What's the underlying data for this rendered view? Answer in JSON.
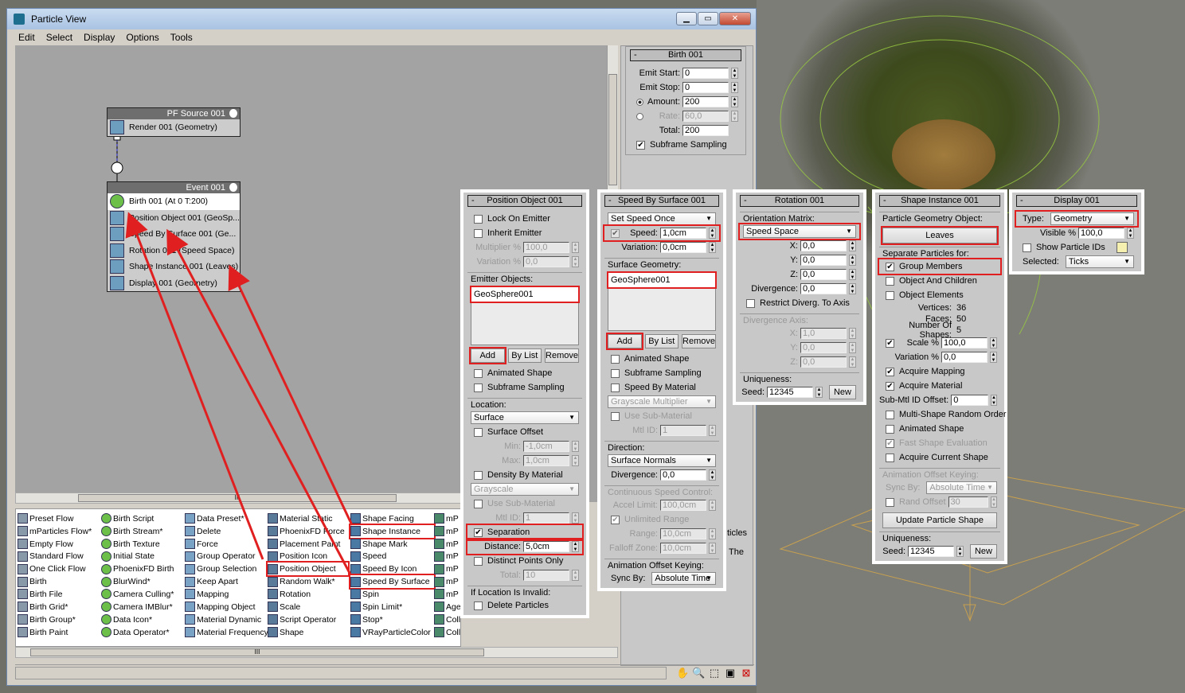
{
  "window": {
    "title": "Particle View",
    "buttons": [
      "▁",
      "▭",
      "✕"
    ]
  },
  "menu": [
    "Edit",
    "Select",
    "Display",
    "Options",
    "Tools"
  ],
  "graph": {
    "source_node": {
      "title": "PF Source 001",
      "rows": [
        {
          "label": "Render 001 (Geometry)",
          "icon": "render-icon"
        }
      ]
    },
    "event_node": {
      "title": "Event 001",
      "rows": [
        {
          "label": "Birth 001 (At 0 T:200)",
          "icon": "birth-icon",
          "selected": true
        },
        {
          "label": "Position Object 001 (GeoSp...",
          "icon": "position-object-icon"
        },
        {
          "label": "Speed By Surface 001 (Ge...",
          "icon": "speed-icon"
        },
        {
          "label": "Rotation 001 (Speed Space)",
          "icon": "rotation-icon"
        },
        {
          "label": "Shape Instance 001 (Leaves)",
          "icon": "shape-instance-icon"
        },
        {
          "label": "Display 001 (Geometry)",
          "icon": "display-icon"
        }
      ]
    }
  },
  "depot": [
    [
      {
        "label": "Preset Flow"
      },
      {
        "label": "mParticles Flow*"
      },
      {
        "label": "Empty Flow"
      },
      {
        "label": "Standard Flow"
      },
      {
        "label": "One Click Flow"
      },
      {
        "label": "Birth"
      },
      {
        "label": "Birth File"
      },
      {
        "label": "Birth Grid*"
      },
      {
        "label": "Birth Group*"
      },
      {
        "label": "Birth Paint"
      }
    ],
    [
      {
        "label": "Birth Script"
      },
      {
        "label": "Birth Stream*"
      },
      {
        "label": "Birth Texture"
      },
      {
        "label": "Initial State"
      },
      {
        "label": "PhoenixFD Birth"
      },
      {
        "label": "BlurWind*"
      },
      {
        "label": "Camera Culling*"
      },
      {
        "label": "Camera IMBlur*"
      },
      {
        "label": "Data Icon*"
      },
      {
        "label": "Data Operator*"
      }
    ],
    [
      {
        "label": "Data Preset*"
      },
      {
        "label": "Delete"
      },
      {
        "label": "Force"
      },
      {
        "label": "Group Operator"
      },
      {
        "label": "Group Selection"
      },
      {
        "label": "Keep Apart"
      },
      {
        "label": "Mapping"
      },
      {
        "label": "Mapping Object"
      },
      {
        "label": "Material Dynamic"
      },
      {
        "label": "Material Frequency"
      }
    ],
    [
      {
        "label": "Material Static"
      },
      {
        "label": "PhoenixFD Force"
      },
      {
        "label": "Placement Paint"
      },
      {
        "label": "Position Icon"
      },
      {
        "label": "Position Object",
        "highlighted": true
      },
      {
        "label": "Random Walk*"
      },
      {
        "label": "Rotation"
      },
      {
        "label": "Scale"
      },
      {
        "label": "Script Operator"
      },
      {
        "label": "Shape"
      }
    ],
    [
      {
        "label": "Shape Facing"
      },
      {
        "label": "Shape Instance",
        "highlighted": true
      },
      {
        "label": "Shape Mark"
      },
      {
        "label": "Speed"
      },
      {
        "label": "Speed By Icon"
      },
      {
        "label": "Speed By Surface",
        "highlighted": true
      },
      {
        "label": "Spin"
      },
      {
        "label": "Spin Limit*"
      },
      {
        "label": "Stop*"
      },
      {
        "label": "VRayParticleColor"
      }
    ],
    [
      {
        "label": "mP"
      },
      {
        "label": "mP"
      },
      {
        "label": "mP"
      },
      {
        "label": "mP"
      },
      {
        "label": "mP"
      },
      {
        "label": "mP"
      },
      {
        "label": "mP"
      },
      {
        "label": "Age"
      },
      {
        "label": "Coll"
      },
      {
        "label": "Coll"
      }
    ]
  ],
  "stray_text": [
    "ticles",
    "The"
  ],
  "nav_icons": [
    "pan-hand-icon",
    "zoom-icon",
    "zoom-region-icon",
    "zoom-extents-icon",
    "no-icon"
  ],
  "accent_highlight": "#e02020",
  "panels": [
    {
      "id": "birth",
      "title": "Birth 001",
      "rows": [
        {
          "t": "spin",
          "label": "Emit Start:",
          "value": "0"
        },
        {
          "t": "spin",
          "label": "Emit Stop:",
          "value": "0"
        },
        {
          "t": "spin",
          "label": "Amount:",
          "value": "200",
          "radio": true,
          "on": true
        },
        {
          "t": "spin",
          "label": "Rate:",
          "value": "60,0",
          "radio": true,
          "dis": true
        },
        {
          "t": "spin",
          "label": "Total:",
          "value": "200",
          "nospin": true
        },
        {
          "t": "check",
          "label": "Subframe Sampling",
          "checked": true
        }
      ]
    },
    {
      "id": "posobj",
      "title": "Position Object 001",
      "rows": [
        {
          "t": "check",
          "label": "Lock On Emitter"
        },
        {
          "t": "check",
          "label": "Inherit Emitter"
        },
        {
          "t": "spin",
          "label": "Multiplier %",
          "value": "100,0",
          "dis": true
        },
        {
          "t": "spin",
          "label": "Variation %",
          "value": "0,0",
          "dis": true
        },
        {
          "t": "group",
          "label": "Emitter Objects:"
        },
        {
          "t": "list",
          "items": [
            {
              "label": "GeoSphere001",
              "hl": true
            }
          ]
        },
        {
          "t": "btns",
          "items": [
            {
              "label": "Add",
              "hl": true
            },
            {
              "label": "By List"
            },
            {
              "label": "Remove"
            }
          ]
        },
        {
          "t": "check",
          "label": "Animated Shape"
        },
        {
          "t": "check",
          "label": "Subframe Sampling"
        },
        {
          "t": "group",
          "label": "Location:"
        },
        {
          "t": "drop",
          "value": "Surface"
        },
        {
          "t": "check",
          "label": "Surface Offset"
        },
        {
          "t": "spin",
          "label": "Min:",
          "value": "-1,0cm",
          "dis": true
        },
        {
          "t": "spin",
          "label": "Max:",
          "value": "1,0cm",
          "dis": true
        },
        {
          "t": "check",
          "label": "Density By Material"
        },
        {
          "t": "drop",
          "value": "Grayscale",
          "dis": true
        },
        {
          "t": "check",
          "label": "Use Sub-Material",
          "dis": true
        },
        {
          "t": "spin",
          "label": "Mtl ID:",
          "value": "1",
          "dis": true
        },
        {
          "t": "check",
          "label": "Separation",
          "checked": true,
          "hl": true
        },
        {
          "t": "spin",
          "label": "Distance:",
          "value": "5,0cm",
          "hl": true
        },
        {
          "t": "check",
          "label": "Distinct Points Only"
        },
        {
          "t": "spin",
          "label": "Total:",
          "value": "10",
          "dis": true
        },
        {
          "t": "group",
          "label": "If Location Is Invalid:"
        },
        {
          "t": "check",
          "label": "Delete Particles"
        }
      ]
    },
    {
      "id": "speed",
      "title": "Speed By Surface 001",
      "rows": [
        {
          "t": "drop",
          "value": "Set Speed Once"
        },
        {
          "t": "spin",
          "label": "Speed:",
          "value": "1,0cm",
          "hl": true,
          "check": true
        },
        {
          "t": "spin",
          "label": "Variation:",
          "value": "0,0cm"
        },
        {
          "t": "group",
          "label": "Surface Geometry:"
        },
        {
          "t": "list",
          "items": [
            {
              "label": "GeoSphere001",
              "hl": true
            }
          ]
        },
        {
          "t": "btns",
          "items": [
            {
              "label": "Add",
              "hl": true
            },
            {
              "label": "By List"
            },
            {
              "label": "Remove"
            }
          ]
        },
        {
          "t": "check",
          "label": "Animated Shape"
        },
        {
          "t": "check",
          "label": "Subframe Sampling"
        },
        {
          "t": "check",
          "label": "Speed By Material"
        },
        {
          "t": "drop",
          "value": "Grayscale Multiplier",
          "dis": true
        },
        {
          "t": "check",
          "label": "Use Sub-Material",
          "dis": true
        },
        {
          "t": "spin",
          "label": "Mtl ID:",
          "value": "1",
          "dis": true
        },
        {
          "t": "group",
          "label": "Direction:"
        },
        {
          "t": "drop",
          "value": "Surface Normals"
        },
        {
          "t": "spin",
          "label": "Divergence:",
          "value": "0,0"
        },
        {
          "t": "group",
          "label": "Continuous Speed Control:",
          "dis": true
        },
        {
          "t": "spin",
          "label": "Accel Limit:",
          "value": "100,0cm",
          "dis": true
        },
        {
          "t": "check",
          "label": "Unlimited Range",
          "checked": true,
          "dis": true
        },
        {
          "t": "spin",
          "label": "Range:",
          "value": "10,0cm",
          "dis": true
        },
        {
          "t": "spin",
          "label": "Falloff Zone:",
          "value": "10,0cm",
          "dis": true
        },
        {
          "t": "group",
          "label": "Animation Offset Keying:"
        },
        {
          "t": "drop",
          "label": "Sync By:",
          "value": "Absolute Time"
        }
      ]
    },
    {
      "id": "rotation",
      "title": "Rotation 001",
      "rows": [
        {
          "t": "group",
          "label": "Orientation Matrix:"
        },
        {
          "t": "drop",
          "value": "Speed Space",
          "hl": true
        },
        {
          "t": "spin",
          "label": "X:",
          "value": "0,0"
        },
        {
          "t": "spin",
          "label": "Y:",
          "value": "0,0"
        },
        {
          "t": "spin",
          "label": "Z:",
          "value": "0,0"
        },
        {
          "t": "spin",
          "label": "Divergence:",
          "value": "0,0"
        },
        {
          "t": "check",
          "label": "Restrict Diverg. To Axis"
        },
        {
          "t": "group",
          "label": "Divergence Axis:",
          "dis": true
        },
        {
          "t": "spin",
          "label": "X:",
          "value": "1,0",
          "dis": true
        },
        {
          "t": "spin",
          "label": "Y:",
          "value": "0,0",
          "dis": true
        },
        {
          "t": "spin",
          "label": "Z:",
          "value": "0,0",
          "dis": true
        },
        {
          "t": "group",
          "label": "Uniqueness:"
        },
        {
          "t": "seed",
          "label": "Seed:",
          "value": "12345",
          "button": "New"
        }
      ]
    },
    {
      "id": "shape",
      "title": "Shape Instance 001",
      "rows": [
        {
          "t": "group",
          "label": "Particle Geometry Object:"
        },
        {
          "t": "bigbtn",
          "label": "Leaves",
          "hl": true
        },
        {
          "t": "group",
          "label": "Separate Particles for:"
        },
        {
          "t": "check",
          "label": "Group Members",
          "checked": true,
          "hl": true
        },
        {
          "t": "check",
          "label": "Object And Children"
        },
        {
          "t": "check",
          "label": "Object Elements"
        },
        {
          "t": "info",
          "label": "Vertices:",
          "value": "36"
        },
        {
          "t": "info",
          "label": "Faces:",
          "value": "50"
        },
        {
          "t": "info",
          "label": "Number Of Shapes:",
          "value": "5"
        },
        {
          "t": "spin",
          "label": "Scale %",
          "value": "100,0",
          "check": true,
          "checked": true
        },
        {
          "t": "spin",
          "label": "Variation %",
          "value": "0,0"
        },
        {
          "t": "check",
          "label": "Acquire Mapping",
          "checked": true
        },
        {
          "t": "check",
          "label": "Acquire Material",
          "checked": true
        },
        {
          "t": "spin",
          "label": "Sub-Mtl ID Offset:",
          "value": "0"
        },
        {
          "t": "check",
          "label": "Multi-Shape Random Order"
        },
        {
          "t": "check",
          "label": "Animated Shape"
        },
        {
          "t": "check",
          "label": "Fast Shape Evaluation",
          "checked": true,
          "dis": true
        },
        {
          "t": "check",
          "label": "Acquire Current Shape"
        },
        {
          "t": "group",
          "label": "Animation Offset Keying:",
          "dis": true
        },
        {
          "t": "drop",
          "label": "Sync By:",
          "value": "Absolute Time",
          "dis": true
        },
        {
          "t": "spin",
          "label": "Rand Offset",
          "value": "30",
          "check": true,
          "dis": true
        },
        {
          "t": "bigbtn",
          "label": "Update Particle Shape"
        },
        {
          "t": "group",
          "label": "Uniqueness:"
        },
        {
          "t": "seed",
          "label": "Seed:",
          "value": "12345",
          "button": "New"
        }
      ]
    },
    {
      "id": "display",
      "title": "Display 001",
      "rows": [
        {
          "t": "drop",
          "label": "Type:",
          "value": "Geometry",
          "hl": true
        },
        {
          "t": "spin",
          "label": "Visible %",
          "value": "100,0"
        },
        {
          "t": "check",
          "label": "Show Particle IDs",
          "swatch": "#f5f0b0"
        },
        {
          "t": "drop",
          "label": "Selected:",
          "value": "Ticks"
        }
      ]
    }
  ]
}
